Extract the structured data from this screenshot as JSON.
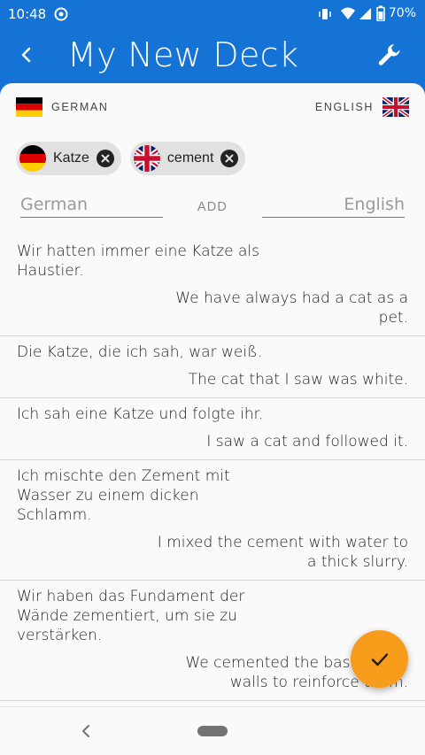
{
  "status": {
    "time": "10:48",
    "battery": "70%"
  },
  "header": {
    "title": "My New Deck"
  },
  "languages": {
    "source": "GERMAN",
    "target": "ENGLISH"
  },
  "filters": [
    {
      "flag": "de",
      "label": "Katze"
    },
    {
      "flag": "uk",
      "label": "cement"
    }
  ],
  "add_form": {
    "source_placeholder": "German",
    "target_placeholder": "English",
    "add_label": "ADD"
  },
  "entries": [
    {
      "german": "Wir hatten immer eine Katze als Haustier.",
      "english": "We have always had a cat as a pet."
    },
    {
      "german": "Die Katze, die ich sah, war weiß.",
      "english": "The cat that I saw was white."
    },
    {
      "german": "Ich sah eine Katze und folgte ihr.",
      "english": "I saw a cat and followed it."
    },
    {
      "german": "Ich mischte den Zement mit Wasser zu einem dicken Schlamm.",
      "english": "I mixed the cement with water to a thick slurry."
    },
    {
      "german": "Wir haben das Fundament der Wände zementiert, um sie zu verstärken.",
      "english": "We cemented the base of the walls to reinforce them."
    }
  ],
  "icons": {
    "back": "chevron-left-icon",
    "settings": "wrench-icon",
    "confirm": "check-icon",
    "remove": "close-circle-icon"
  },
  "colors": {
    "primary": "#1473d4",
    "accent": "#f79c1b",
    "sheet": "#fafafa",
    "chip": "#e1e1e1"
  }
}
